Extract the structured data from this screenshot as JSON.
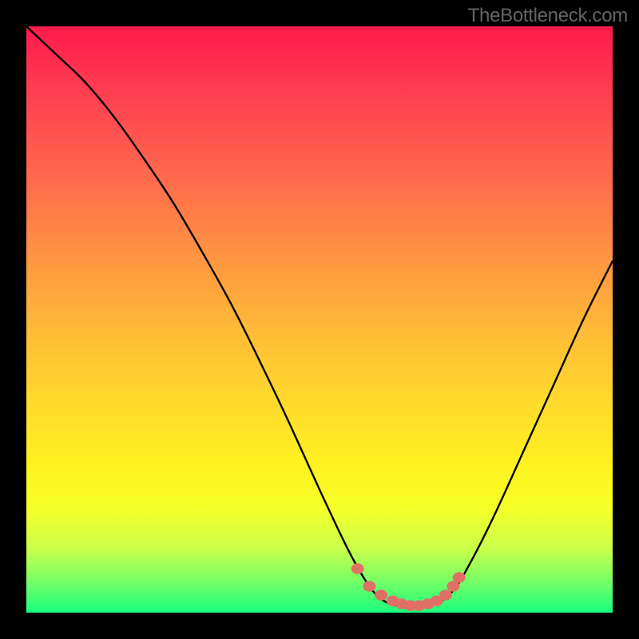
{
  "watermark": "TheBottleneck.com",
  "colors": {
    "background": "#000000",
    "curve_stroke": "#000000",
    "marker_fill": "#e07066",
    "gradient_top": "#ff1a4b",
    "gradient_bottom": "#1aff7e",
    "watermark_text": "#646464"
  },
  "chart_data": {
    "type": "line",
    "title": "",
    "xlabel": "",
    "ylabel": "",
    "xlim": [
      0,
      1
    ],
    "ylim": [
      0,
      1
    ],
    "x": [
      0.0,
      0.05,
      0.1,
      0.15,
      0.2,
      0.25,
      0.3,
      0.35,
      0.4,
      0.45,
      0.5,
      0.55,
      0.585,
      0.61,
      0.64,
      0.67,
      0.7,
      0.73,
      0.76,
      0.8,
      0.85,
      0.9,
      0.95,
      1.0
    ],
    "y": [
      1.0,
      0.953,
      0.905,
      0.845,
      0.775,
      0.7,
      0.615,
      0.525,
      0.425,
      0.32,
      0.21,
      0.105,
      0.045,
      0.02,
      0.01,
      0.01,
      0.015,
      0.04,
      0.09,
      0.17,
      0.28,
      0.39,
      0.5,
      0.6
    ],
    "markers": {
      "x": [
        0.565,
        0.585,
        0.605,
        0.625,
        0.64,
        0.655,
        0.67,
        0.685,
        0.7,
        0.715,
        0.728,
        0.738
      ],
      "y": [
        0.075,
        0.045,
        0.03,
        0.02,
        0.015,
        0.012,
        0.012,
        0.015,
        0.02,
        0.03,
        0.045,
        0.06
      ]
    },
    "annotations": []
  }
}
